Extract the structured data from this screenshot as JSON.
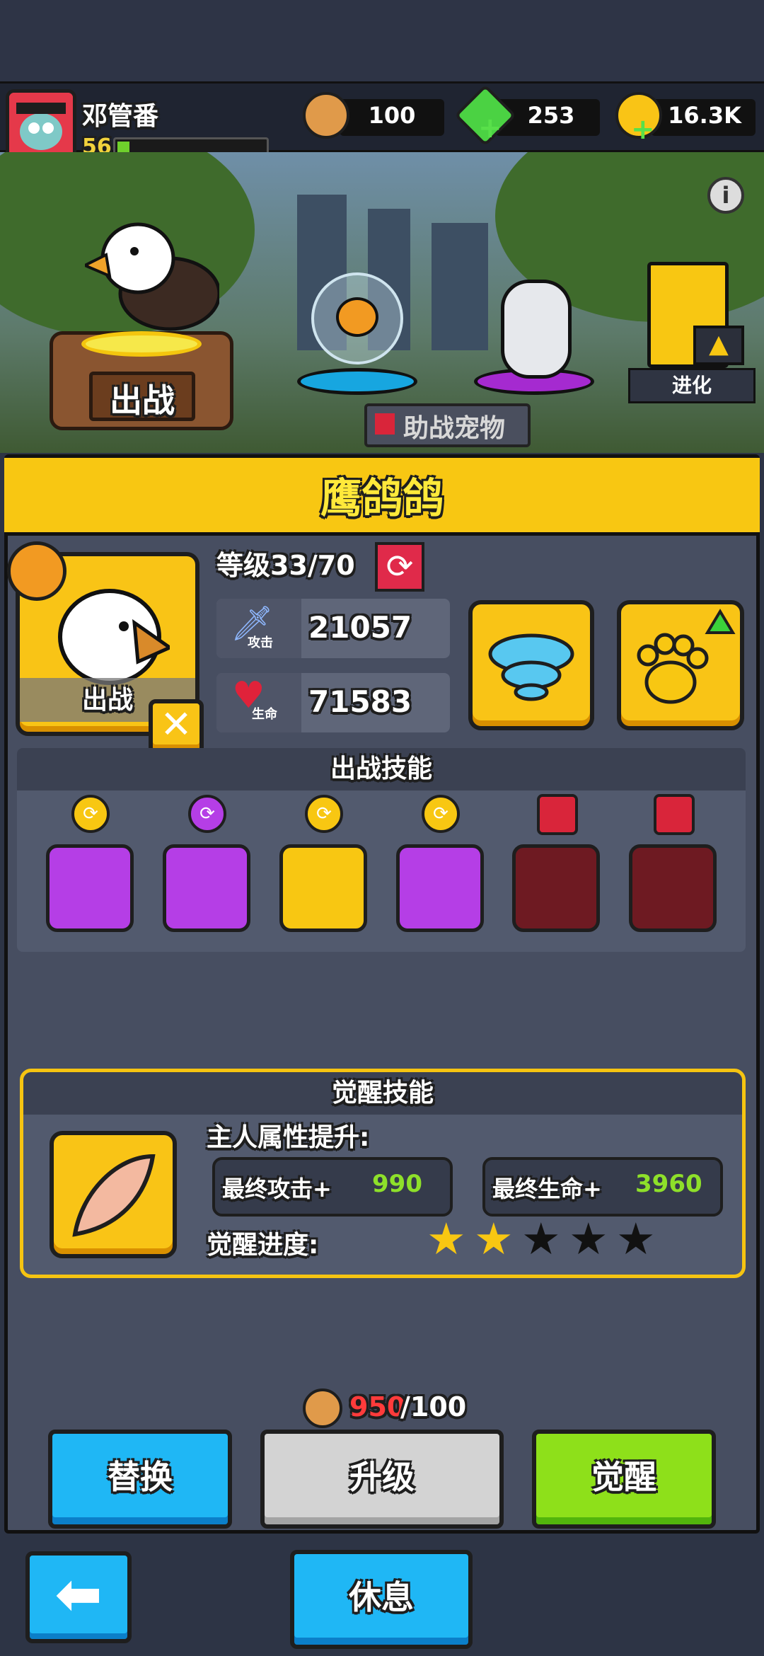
{
  "player": {
    "name": "邓管番",
    "level": "56",
    "xp_fraction": 0.08
  },
  "resources": [
    {
      "name": "dog-token",
      "value": "100"
    },
    {
      "name": "green-gem",
      "value": "253"
    },
    {
      "name": "gold-coin",
      "value": "16.3K"
    }
  ],
  "scene": {
    "deploy_label": "出战",
    "assist_label": "助战宠物",
    "evolve_label": "进化"
  },
  "pet": {
    "name": "鹰鸽鸽",
    "card_label": "出战",
    "level_text": "等级33/70",
    "attack_tag": "攻击",
    "attack": "21057",
    "hp_tag": "生命",
    "hp": "71583"
  },
  "skills": {
    "title": "出战技能"
  },
  "awaken": {
    "title": "觉醒技能",
    "boost_label": "主人属性提升:",
    "atk_label": "最终攻击+",
    "atk_value": "990",
    "hp_label": "最终生命+",
    "hp_value": "3960",
    "progress_label": "觉醒进度:",
    "stars_filled": 2,
    "stars_total": 5
  },
  "cost": {
    "current": "950",
    "required": "/100"
  },
  "buttons": {
    "replace": "替换",
    "upgrade": "升级",
    "awaken": "觉醒",
    "rest": "休息"
  },
  "colors": {
    "accent_yellow": "#f9c416",
    "blue_btn": "#1fb7f5",
    "green_btn": "#8ee01a",
    "purple_skill": "#b53ee6",
    "locked_skill": "#6e1a22"
  }
}
